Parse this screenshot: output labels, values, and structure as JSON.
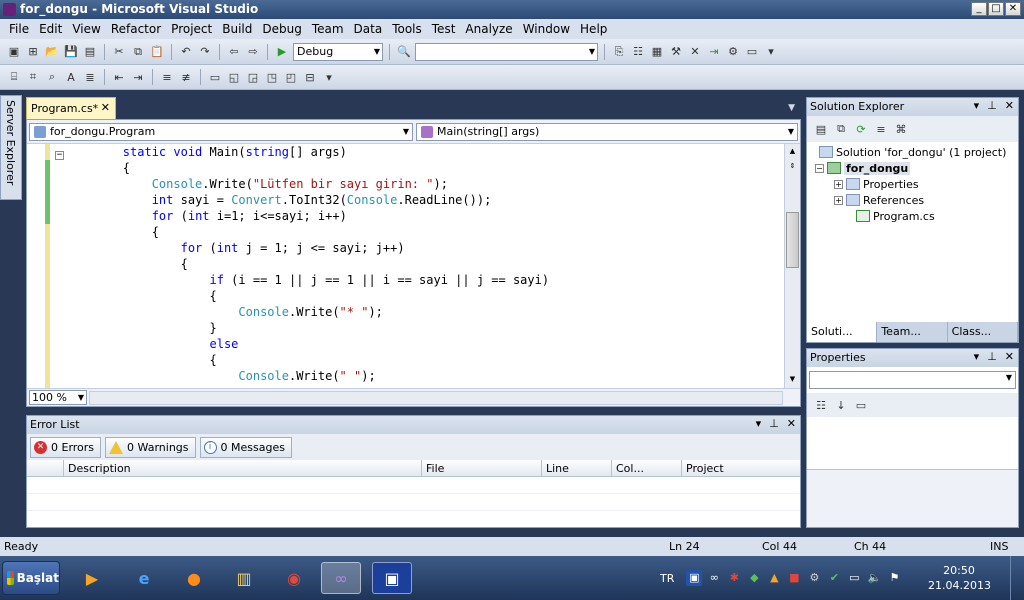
{
  "window": {
    "title": "for_dongu - Microsoft Visual Studio",
    "min": "_",
    "max": "□",
    "close": "✕"
  },
  "menu": [
    "File",
    "Edit",
    "View",
    "Refactor",
    "Project",
    "Build",
    "Debug",
    "Team",
    "Data",
    "Tools",
    "Test",
    "Analyze",
    "Window",
    "Help"
  ],
  "toolbar": {
    "config": "Debug",
    "platform": ""
  },
  "server_explorer": "Server Explorer",
  "doc_tab": {
    "name": "Program.cs*",
    "close": "✕"
  },
  "nav": {
    "class_combo": "for_dongu.Program",
    "member_combo": "Main(string[] args)"
  },
  "code": {
    "lines": [
      {
        "indent": "        ",
        "parts": [
          [
            "kw",
            "static"
          ],
          [
            "",
            ""
          ],
          [
            "kw",
            " void"
          ],
          [
            "",
            " Main("
          ],
          [
            "kw",
            "string"
          ],
          [
            "",
            "[] args)"
          ]
        ]
      },
      {
        "indent": "        ",
        "parts": [
          [
            "",
            "{"
          ]
        ]
      },
      {
        "indent": "            ",
        "parts": [
          [
            "ty",
            "Console"
          ],
          [
            "",
            ".Write("
          ],
          [
            "st",
            "\"Lütfen bir sayı girin: \""
          ],
          [
            "",
            ");"
          ]
        ]
      },
      {
        "indent": "            ",
        "parts": [
          [
            "kw",
            "int"
          ],
          [
            "",
            " sayi = "
          ],
          [
            "ty",
            "Convert"
          ],
          [
            "",
            ".ToInt32("
          ],
          [
            "ty",
            "Console"
          ],
          [
            "",
            ".ReadLine());"
          ]
        ]
      },
      {
        "indent": "            ",
        "parts": [
          [
            "kw",
            "for"
          ],
          [
            "",
            " ("
          ],
          [
            "kw",
            "int"
          ],
          [
            "",
            " i=1; i<=sayi; i++)"
          ]
        ]
      },
      {
        "indent": "            ",
        "parts": [
          [
            "",
            "{"
          ]
        ]
      },
      {
        "indent": "                ",
        "parts": [
          [
            "kw",
            "for"
          ],
          [
            "",
            " ("
          ],
          [
            "kw",
            "int"
          ],
          [
            "",
            " j = 1; j <= sayi; j++)"
          ]
        ]
      },
      {
        "indent": "                ",
        "parts": [
          [
            "",
            "{"
          ]
        ]
      },
      {
        "indent": "                    ",
        "parts": [
          [
            "kw",
            "if"
          ],
          [
            "",
            " (i == 1 || j == 1 || i == sayi || j == sayi)"
          ]
        ]
      },
      {
        "indent": "                    ",
        "parts": [
          [
            "",
            "{"
          ]
        ]
      },
      {
        "indent": "                        ",
        "parts": [
          [
            "ty",
            "Console"
          ],
          [
            "",
            ".Write("
          ],
          [
            "st",
            "\"* \""
          ],
          [
            "",
            ");"
          ]
        ]
      },
      {
        "indent": "                    ",
        "parts": [
          [
            "",
            "}"
          ]
        ]
      },
      {
        "indent": "                    ",
        "parts": [
          [
            "kw",
            "else"
          ]
        ]
      },
      {
        "indent": "                    ",
        "parts": [
          [
            "",
            "{"
          ]
        ]
      },
      {
        "indent": "                        ",
        "parts": [
          [
            "ty",
            "Console"
          ],
          [
            "",
            ".Write("
          ],
          [
            "st",
            "\" \""
          ],
          [
            "",
            ");"
          ]
        ]
      }
    ]
  },
  "zoom": "100 %",
  "error_list": {
    "title": "Error List",
    "errors": "0 Errors",
    "warnings": "0 Warnings",
    "messages": "0 Messages",
    "columns": [
      "Description",
      "File",
      "Line",
      "Col...",
      "Project"
    ]
  },
  "solution_explorer": {
    "title": "Solution Explorer",
    "solution": "Solution 'for_dongu' (1 project)",
    "project": "for_dongu",
    "items": [
      "Properties",
      "References",
      "Program.cs"
    ],
    "tabs": [
      "Soluti...",
      "Team...",
      "Class..."
    ]
  },
  "properties": {
    "title": "Properties"
  },
  "status": {
    "ready": "Ready",
    "ln": "Ln 24",
    "col": "Col 44",
    "ch": "Ch 44",
    "ins": "INS"
  },
  "taskbar": {
    "start": "Başlat",
    "lang": "TR",
    "time": "20:50",
    "date": "21.04.2013"
  }
}
